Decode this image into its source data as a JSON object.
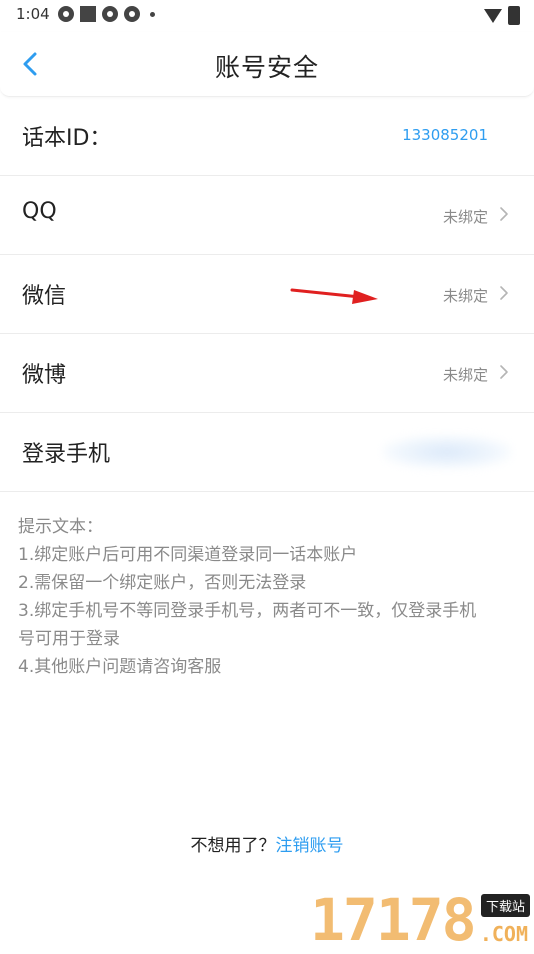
{
  "status_bar": {
    "time": "1:04"
  },
  "header": {
    "title": "账号安全"
  },
  "rows": [
    {
      "label": "话本ID：",
      "value": "133085201"
    },
    {
      "label": "QQ",
      "status": "未绑定"
    },
    {
      "label": "微信",
      "status": "未绑定"
    },
    {
      "label": "微博",
      "status": "未绑定"
    },
    {
      "label": "登录手机"
    }
  ],
  "tips": {
    "title": "提示文本：",
    "lines": [
      "1.绑定账户后可用不同渠道登录同一话本账户",
      "2.需保留一个绑定账户，否则无法登录",
      "3.绑定手机号不等同登录手机号，两者可不一致，仅登录手机",
      "号可用于登录",
      "4.其他账户问题请咨询客服"
    ]
  },
  "footer": {
    "prompt": "不想用了？",
    "link": "注销账号"
  },
  "watermark": {
    "number": "17178",
    "badge": "下载站",
    "domain": ".COM"
  },
  "colors": {
    "accent": "#2e9df0",
    "muted": "#8a8a8a",
    "arrow": "#e02020"
  }
}
